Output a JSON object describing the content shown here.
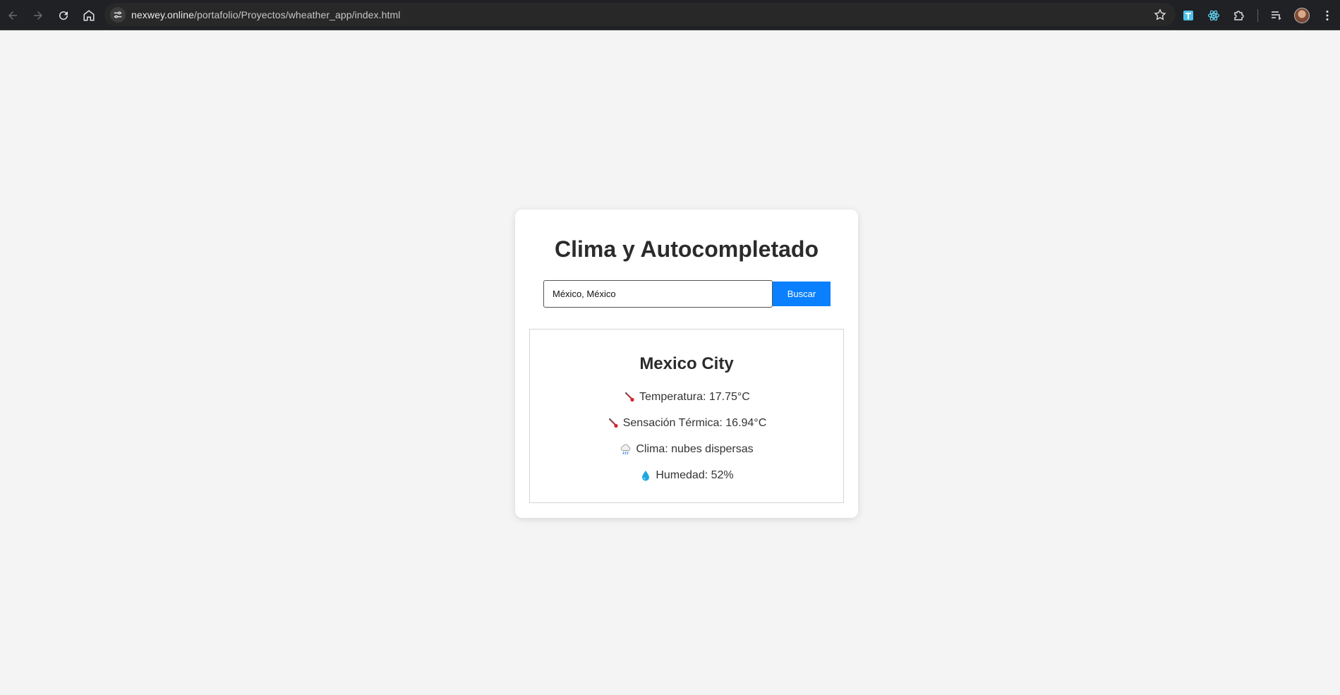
{
  "browser": {
    "url_host": "nexwey.online",
    "url_path": "/portafolio/Proyectos/wheather_app/index.html"
  },
  "app": {
    "title": "Clima y Autocompletado",
    "search": {
      "value": "México, México",
      "button_label": "Buscar"
    },
    "result": {
      "city": "Mexico City",
      "temperature_label": "Temperatura: 17.75°C",
      "feels_like_label": "Sensación Térmica: 16.94°C",
      "weather_label": "Clima: nubes dispersas",
      "humidity_label": "Humedad: 52%"
    }
  },
  "colors": {
    "page_bg": "#f4f4f4",
    "accent": "#0a80ff",
    "browser_bg": "#202124"
  },
  "icons": {
    "temperature": "thermometer-icon",
    "feels_like": "thermometer-icon",
    "weather": "cloud-rain-icon",
    "humidity": "droplet-icon"
  }
}
